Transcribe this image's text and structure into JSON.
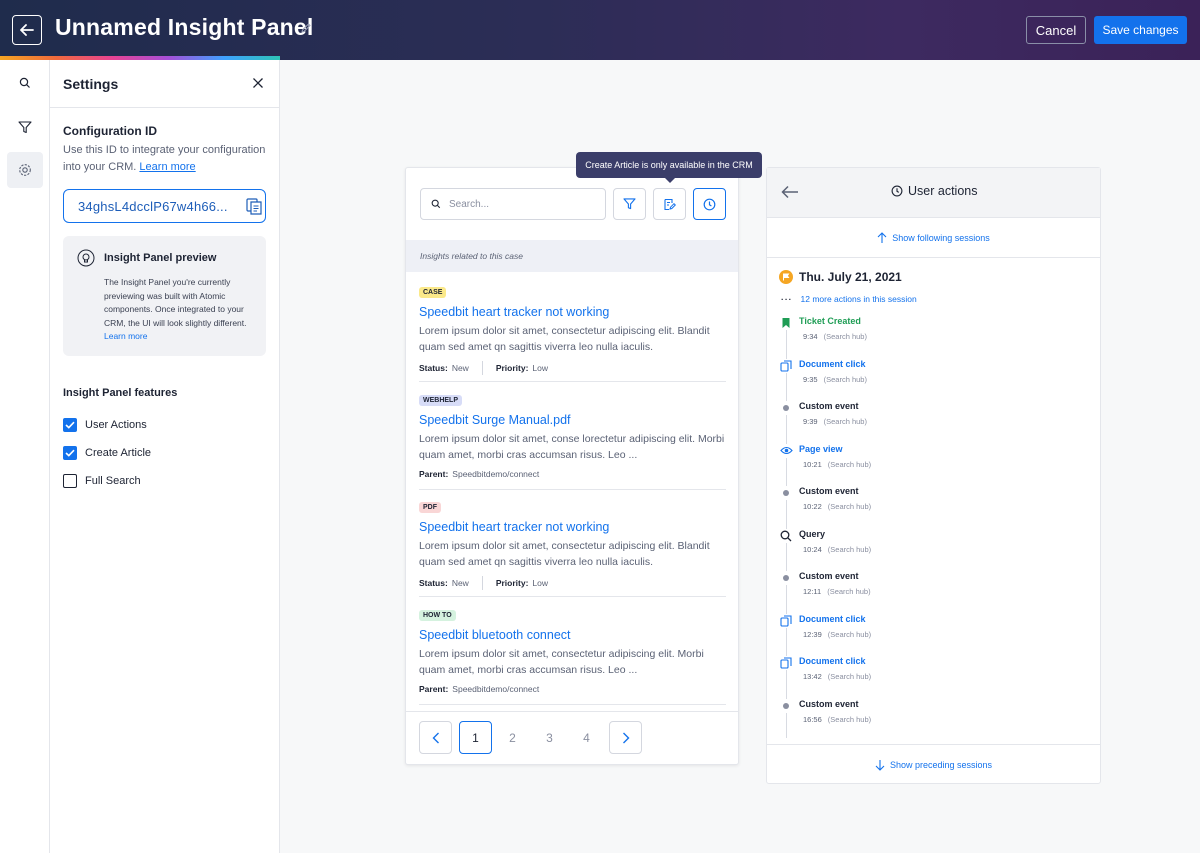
{
  "header": {
    "title": "Unnamed Insight Panel",
    "cancel_label": "Cancel",
    "save_label": "Save changes"
  },
  "settings": {
    "title": "Settings",
    "config_title": "Configuration ID",
    "config_desc": "Use this ID to integrate your configuration into your CRM.",
    "learn_more": "Learn more",
    "config_id": "34ghsL4dcclP67w4h66...",
    "preview_title": "Insight Panel preview",
    "preview_text": "The Insight Panel you're currently previewing was built with Atomic components. Once integrated to your CRM, the UI will look slightly different.",
    "features_title": "Insight Panel features",
    "features": [
      {
        "label": "User Actions",
        "checked": true
      },
      {
        "label": "Create Article",
        "checked": true
      },
      {
        "label": "Full Search",
        "checked": false
      }
    ]
  },
  "insight_panel": {
    "search_placeholder": "Search...",
    "tooltip": "Create Article is only available in the CRM",
    "related_label": "Insights related to this case",
    "results": [
      {
        "badge": "CASE",
        "badge_color": "#fbe98a",
        "title": "Speedbit heart tracker not working",
        "body": "Lorem ipsum dolor sit amet, consectetur adipiscing elit. Blandit quam sed amet qn sagittis viverra leo nulla iaculis.",
        "meta1_label": "Status:",
        "meta1_value": "New",
        "meta2_label": "Priority:",
        "meta2_value": "Low"
      },
      {
        "badge": "WEBHELP",
        "badge_color": "#d7dcf7",
        "title": "Speedbit Surge Manual.pdf",
        "body": "Lorem ipsum dolor sit amet, conse lorectetur adipiscing elit. Morbi quam amet, morbi cras accumsan risus. Leo ...",
        "meta1_label": "Parent:",
        "meta1_value": "Speedbitdemo/connect"
      },
      {
        "badge": "PDF",
        "badge_color": "#f9d6d6",
        "title": "Speedbit heart tracker not working",
        "body": "Lorem ipsum dolor sit amet, consectetur adipiscing elit. Blandit quam sed amet qn sagittis viverra leo nulla iaculis.",
        "meta1_label": "Status:",
        "meta1_value": "New",
        "meta2_label": "Priority:",
        "meta2_value": "Low"
      },
      {
        "badge": "HOW TO",
        "badge_color": "#d5f2df",
        "title": "Speedbit bluetooth connect",
        "body": "Lorem ipsum dolor sit amet, consectetur adipiscing elit. Morbi quam amet, morbi cras accumsan risus. Leo ...",
        "meta1_label": "Parent:",
        "meta1_value": "Speedbitdemo/connect"
      }
    ],
    "pages": [
      "1",
      "2",
      "3",
      "4"
    ],
    "current_page": "1"
  },
  "user_actions": {
    "title": "User actions",
    "show_following": "Show following sessions",
    "date": "Thu. July 21, 2021",
    "more_actions": "12 more actions in this session",
    "actions": [
      {
        "name": "Ticket Created",
        "time": "9:34",
        "source": "(Search hub)",
        "icon": "bookmark-icon",
        "color": "#1f9d55"
      },
      {
        "name": "Document click",
        "time": "9:35",
        "source": "(Search hub)",
        "icon": "document-icon",
        "color": "#1372ec"
      },
      {
        "name": "Custom event",
        "time": "9:39",
        "source": "(Search hub)",
        "icon": "dot-icon",
        "color": "#1d2333"
      },
      {
        "name": "Page view",
        "time": "10:21",
        "source": "(Search hub)",
        "icon": "eye-icon",
        "color": "#1372ec"
      },
      {
        "name": "Custom event",
        "time": "10:22",
        "source": "(Search hub)",
        "icon": "dot-icon",
        "color": "#1d2333"
      },
      {
        "name": "Query",
        "time": "10:24",
        "source": "(Search hub)",
        "icon": "search-icon",
        "color": "#1d2333"
      },
      {
        "name": "Custom event",
        "time": "12:11",
        "source": "(Search hub)",
        "icon": "dot-icon",
        "color": "#1d2333"
      },
      {
        "name": "Document click",
        "time": "12:39",
        "source": "(Search hub)",
        "icon": "document-icon",
        "color": "#1372ec"
      },
      {
        "name": "Document click",
        "time": "13:42",
        "source": "(Search hub)",
        "icon": "document-icon",
        "color": "#1372ec"
      },
      {
        "name": "Custom event",
        "time": "16:56",
        "source": "(Search hub)",
        "icon": "dot-icon",
        "color": "#1d2333"
      }
    ],
    "show_preceding": "Show preceding sessions"
  },
  "colors": {
    "accent": "#1372ec",
    "header_bg": "#2c2d56",
    "success": "#1f9d55"
  }
}
